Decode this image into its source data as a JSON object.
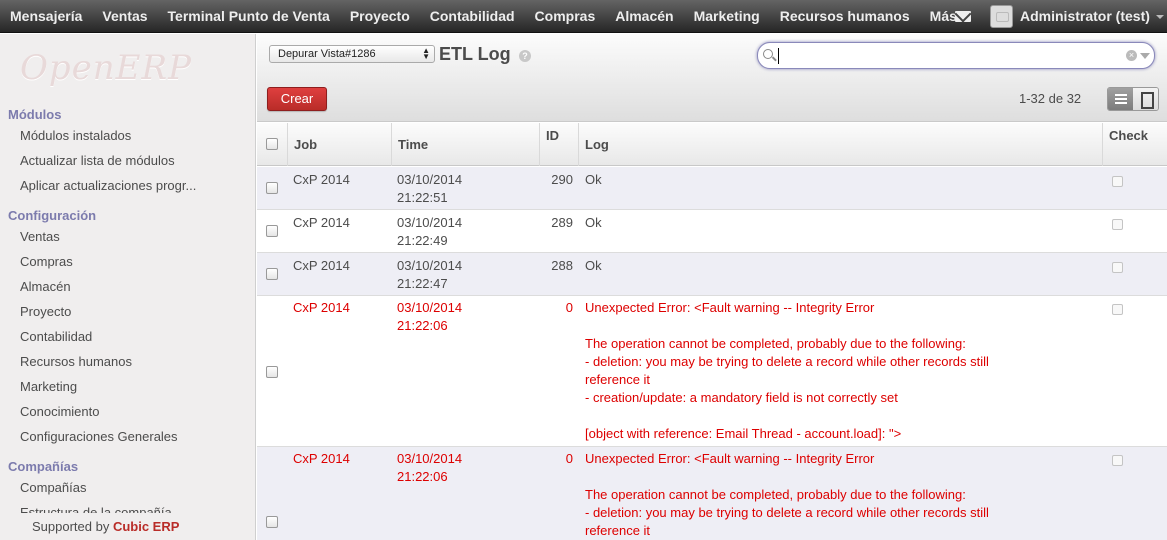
{
  "topbar": {
    "menu": [
      "Mensajería",
      "Ventas",
      "Terminal Punto de Venta",
      "Proyecto",
      "Contabilidad",
      "Compras",
      "Almacén",
      "Marketing",
      "Recursos humanos"
    ],
    "more": "Más",
    "user": "Administrator (test)"
  },
  "sidebar": {
    "logo": "OpenERP",
    "sections": [
      {
        "title": "Módulos",
        "items": [
          "Módulos instalados",
          "Actualizar lista de módulos",
          "Aplicar actualizaciones progr..."
        ]
      },
      {
        "title": "Configuración",
        "items": [
          "Ventas",
          "Compras",
          "Almacén",
          "Proyecto",
          "Contabilidad",
          "Recursos humanos",
          "Marketing",
          "Conocimiento",
          "Configuraciones Generales"
        ]
      },
      {
        "title": "Compañías",
        "items": [
          "Compañías",
          "Estructura de la compañía"
        ]
      }
    ],
    "supported_prefix": "Supported by ",
    "supported_brand": "Cubic ERP"
  },
  "header": {
    "view_select": "Depurar Vista#1286",
    "title": "ETL Log",
    "help": "?",
    "create": "Crear",
    "pager": "1-32 de 32"
  },
  "table": {
    "columns": {
      "job": "Job",
      "time": "Time",
      "id": "ID",
      "log": "Log",
      "check": "Check"
    },
    "rows": [
      {
        "job": "CxP 2014",
        "time1": "03/10/2014",
        "time2": "21:22:51",
        "id": "290",
        "log": "Ok",
        "error": false
      },
      {
        "job": "CxP 2014",
        "time1": "03/10/2014",
        "time2": "21:22:49",
        "id": "289",
        "log": "Ok",
        "error": false
      },
      {
        "job": "CxP 2014",
        "time1": "03/10/2014",
        "time2": "21:22:47",
        "id": "288",
        "log": "Ok",
        "error": false
      },
      {
        "job": "CxP 2014",
        "time1": "03/10/2014",
        "time2": "21:22:06",
        "id": "0",
        "log": "Unexpected Error: <Fault warning -- Integrity Error\n\nThe operation cannot be completed, probably due to the following:\n- deletion: you may be trying to delete a record while other records still\nreference it\n- creation/update: a mandatory field is not correctly set\n\n[object with reference: Email Thread - account.load]: \">",
        "error": true
      },
      {
        "job": "CxP 2014",
        "time1": "03/10/2014",
        "time2": "21:22:06",
        "id": "0",
        "log": "Unexpected Error: <Fault warning -- Integrity Error\n\nThe operation cannot be completed, probably due to the following:\n- deletion: you may be trying to delete a record while other records still\nreference it",
        "error": true
      }
    ]
  }
}
